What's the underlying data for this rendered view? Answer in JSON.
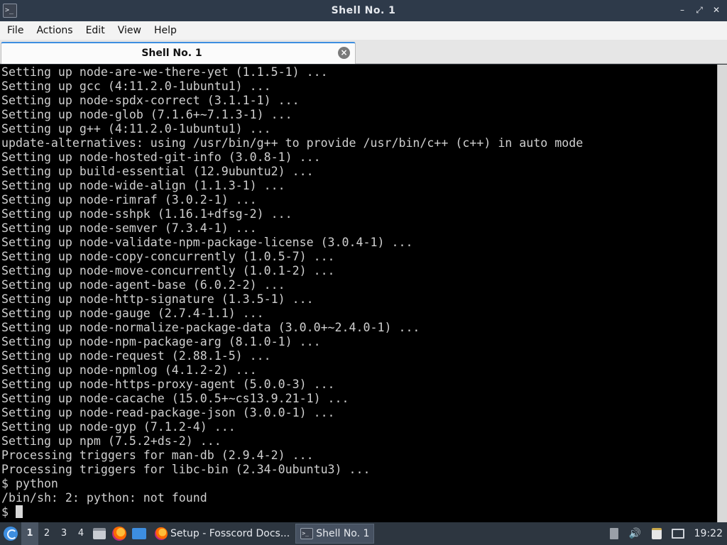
{
  "window": {
    "title": "Shell No. 1",
    "app_icon_glyph": ">_",
    "min_glyph": "–",
    "restore_glyph": "⤢",
    "close_glyph": "✕"
  },
  "menubar": {
    "items": [
      "File",
      "Actions",
      "Edit",
      "View",
      "Help"
    ]
  },
  "tabs": [
    {
      "label": "Shell No. 1",
      "close_glyph": "×"
    }
  ],
  "terminal": {
    "lines": [
      "Setting up node-are-we-there-yet (1.1.5-1) ...",
      "Setting up gcc (4:11.2.0-1ubuntu1) ...",
      "Setting up node-spdx-correct (3.1.1-1) ...",
      "Setting up node-glob (7.1.6+~7.1.3-1) ...",
      "Setting up g++ (4:11.2.0-1ubuntu1) ...",
      "update-alternatives: using /usr/bin/g++ to provide /usr/bin/c++ (c++) in auto mode",
      "Setting up node-hosted-git-info (3.0.8-1) ...",
      "Setting up build-essential (12.9ubuntu2) ...",
      "Setting up node-wide-align (1.1.3-1) ...",
      "Setting up node-rimraf (3.0.2-1) ...",
      "Setting up node-sshpk (1.16.1+dfsg-2) ...",
      "Setting up node-semver (7.3.4-1) ...",
      "Setting up node-validate-npm-package-license (3.0.4-1) ...",
      "Setting up node-copy-concurrently (1.0.5-7) ...",
      "Setting up node-move-concurrently (1.0.1-2) ...",
      "Setting up node-agent-base (6.0.2-2) ...",
      "Setting up node-http-signature (1.3.5-1) ...",
      "Setting up node-gauge (2.7.4-1.1) ...",
      "Setting up node-normalize-package-data (3.0.0+~2.4.0-1) ...",
      "Setting up node-npm-package-arg (8.1.0-1) ...",
      "Setting up node-request (2.88.1-5) ...",
      "Setting up node-npmlog (4.1.2-2) ...",
      "Setting up node-https-proxy-agent (5.0.0-3) ...",
      "Setting up node-cacache (15.0.5+~cs13.9.21-1) ...",
      "Setting up node-read-package-json (3.0.0-1) ...",
      "Setting up node-gyp (7.1.2-4) ...",
      "Setting up npm (7.5.2+ds-2) ...",
      "Processing triggers for man-db (2.9.4-2) ...",
      "Processing triggers for libc-bin (2.34-0ubuntu3) ...",
      "$ python",
      "/bin/sh: 2: python: not found"
    ],
    "prompt": "$ "
  },
  "taskbar": {
    "workspaces": [
      "1",
      "2",
      "3",
      "4"
    ],
    "active_workspace": "1",
    "tasks": [
      {
        "label": "Setup - Fosscord Docs...",
        "icon": "firefox-icon"
      },
      {
        "label": "Shell No. 1",
        "icon": "terminal-icon",
        "term_glyph": ">_"
      }
    ],
    "clock": "19:22",
    "volume_glyph": "🔊"
  },
  "colors": {
    "accent": "#3d8ee0",
    "titlebar": "#2e3a4a",
    "terminal_bg": "#000000",
    "terminal_fg": "#cfcfcf",
    "taskbar": "#2d3640"
  }
}
